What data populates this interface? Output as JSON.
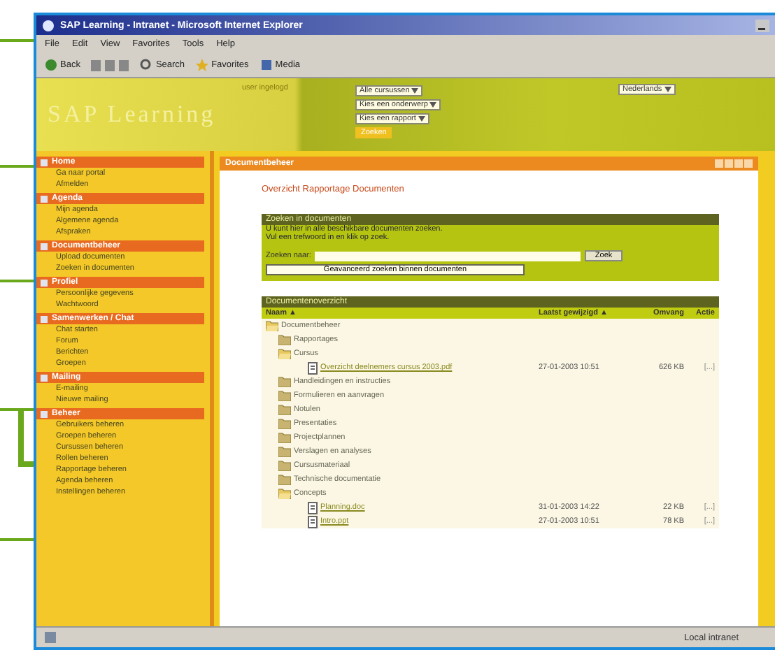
{
  "window": {
    "title": "SAP Learning - Intranet - Microsoft Internet Explorer"
  },
  "menu": [
    "File",
    "Edit",
    "View",
    "Favorites",
    "Tools",
    "Help"
  ],
  "toolbar": [
    {
      "label": "Back",
      "kind": "back"
    },
    {
      "label": "Search",
      "kind": "search"
    },
    {
      "label": "Favorites",
      "kind": "favorites"
    },
    {
      "label": "Media",
      "kind": "media"
    }
  ],
  "header": {
    "logo": "SAP Learning",
    "user": "user ingelogd",
    "selects": [
      "Alle cursussen",
      "Kies een onderwerp",
      "Kies een rapport"
    ],
    "go_button": "Zoeken",
    "right_select": "Nederlands"
  },
  "sidebar": [
    {
      "title": "Home",
      "items": [
        "Ga naar portal",
        "Afmelden"
      ]
    },
    {
      "title": "Agenda",
      "items": [
        "Mijn agenda",
        "Algemene agenda",
        "Afspraken"
      ]
    },
    {
      "title": "Documentbeheer",
      "items": [
        "Upload documenten",
        "Zoeken in documenten"
      ]
    },
    {
      "title": "Profiel",
      "items": [
        "Persoonlijke gegevens",
        "Wachtwoord"
      ]
    },
    {
      "title": "Samenwerken / Chat",
      "items": [
        "Chat starten",
        "Forum",
        "Berichten",
        "Groepen"
      ]
    },
    {
      "title": "Mailing",
      "items": [
        "E-mailing",
        "Nieuwe mailing"
      ]
    },
    {
      "title": "Beheer",
      "items": [
        "Gebruikers beheren",
        "Groepen beheren",
        "Cursussen beheren",
        "Rollen beheren",
        "Rapportage beheren",
        "Agenda beheren",
        "Instellingen beheren"
      ]
    }
  ],
  "panel": {
    "title": "Documentbeheer",
    "heading": "Overzicht Rapportage Documenten",
    "search": {
      "title": "Zoeken in documenten",
      "lines": [
        "U kunt hier in alle beschikbare documenten zoeken.",
        "Vul een trefwoord in en klik op zoek."
      ],
      "label": "Zoeken naar:",
      "button": "Zoek",
      "advanced": "Geavanceerd zoeken binnen documenten"
    },
    "table": {
      "title": "Documentenoverzicht",
      "columns": [
        "Naam ▲",
        "Laatst gewijzigd ▲",
        "Omvang",
        "Actie"
      ],
      "tree": [
        {
          "kind": "folder",
          "name": "Documentbeheer",
          "expanded": true,
          "children": [
            {
              "kind": "folder",
              "name": "Rapportages",
              "expanded": false
            },
            {
              "kind": "folder",
              "name": "Cursus",
              "expanded": true,
              "children": [
                {
                  "kind": "file",
                  "name": "Overzicht deelnemers cursus 2003.pdf",
                  "date": "27-01-2003 10:51",
                  "size": "626 KB",
                  "action": "[...]"
                }
              ]
            },
            {
              "kind": "folder",
              "name": "Handleidingen en instructies",
              "expanded": false
            },
            {
              "kind": "folder",
              "name": "Formulieren en aanvragen",
              "expanded": false
            },
            {
              "kind": "folder",
              "name": "Notulen",
              "expanded": false
            },
            {
              "kind": "folder",
              "name": "Presentaties",
              "expanded": false
            },
            {
              "kind": "folder",
              "name": "Projectplannen",
              "expanded": false
            },
            {
              "kind": "folder",
              "name": "Verslagen en analyses",
              "expanded": false
            },
            {
              "kind": "folder",
              "name": "Cursusmateriaal",
              "expanded": false
            },
            {
              "kind": "folder",
              "name": "Technische documentatie",
              "expanded": false
            },
            {
              "kind": "folder",
              "name": "Concepts",
              "expanded": true,
              "children": [
                {
                  "kind": "file",
                  "name": "Planning.doc",
                  "date": "31-01-2003 14:22",
                  "size": "22 KB",
                  "action": "[...]"
                },
                {
                  "kind": "file",
                  "name": "Intro.ppt",
                  "date": "27-01-2003 10:51",
                  "size": "78 KB",
                  "action": "[...]"
                }
              ]
            }
          ]
        }
      ]
    }
  },
  "status_bar": {
    "zone": "Local intranet"
  }
}
